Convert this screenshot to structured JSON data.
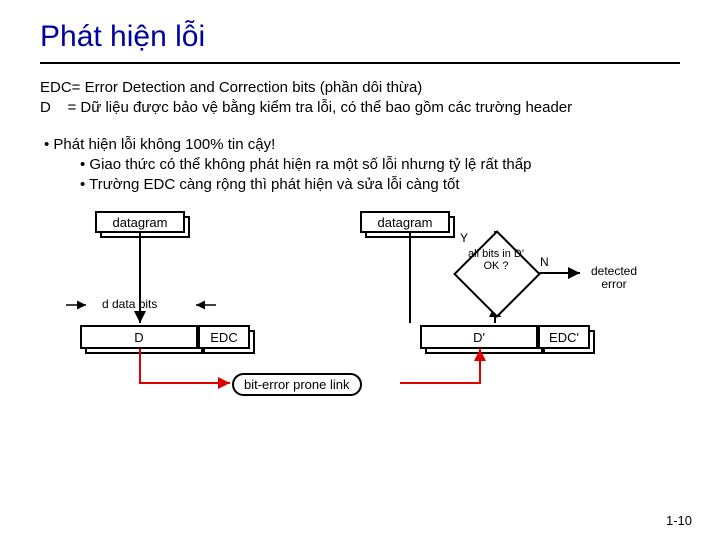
{
  "title": "Phát hiện lỗi",
  "defs": {
    "line1": "EDC= Error Detection and Correction bits (phần dôi thừa)",
    "line2": "D    = Dữ liệu được bảo vệ bằng kiểm tra lỗi, có thể bao gồm các trường header"
  },
  "bullets": {
    "b1": "• Phát hiện lỗi không 100% tin cậy!",
    "b2": "• Giao thức có thể không phát hiện ra một số lỗi nhưng tỷ lệ rất thấp",
    "b3": "• Trường EDC càng rộng thì phát hiện và sửa lỗi càng tốt"
  },
  "diagram": {
    "datagram_left": "datagram",
    "datagram_right": "datagram",
    "decision": "all bits in D' OK ?",
    "decision_yes": "Y",
    "decision_no": "N",
    "detected": "detected error",
    "d_bits_label": "d data bits",
    "D": "D",
    "EDC": "EDC",
    "Dprime": "D'",
    "EDCprime": "EDC'",
    "link": "bit-error prone link"
  },
  "page": "1-10"
}
